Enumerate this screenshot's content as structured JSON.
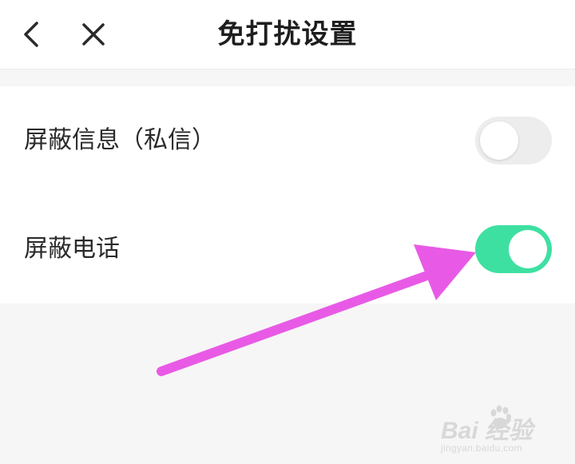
{
  "header": {
    "title": "免打扰设置",
    "back_icon": "chevron-left-icon",
    "close_icon": "close-icon"
  },
  "settings": {
    "items": [
      {
        "label": "屏蔽信息（私信）",
        "enabled": false
      },
      {
        "label": "屏蔽电话",
        "enabled": true
      }
    ]
  },
  "colors": {
    "toggle_on": "#3ee0a2",
    "toggle_off": "#ededed",
    "annotation_arrow": "#e85ae6"
  },
  "watermark": {
    "brand": "Bai  经验",
    "url": "jingyan.baidu.com"
  }
}
